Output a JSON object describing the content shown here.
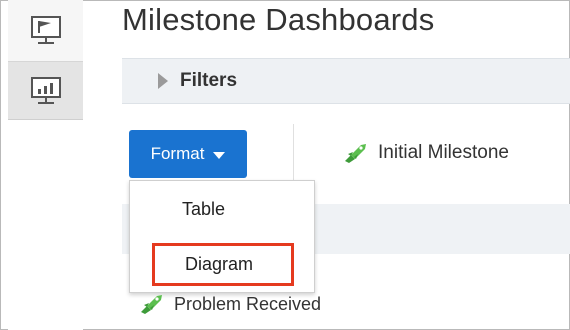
{
  "rail": {
    "tabs": [
      {
        "icon": "presentation-flag-icon"
      },
      {
        "icon": "bar-chart-monitor-icon"
      }
    ]
  },
  "page": {
    "title": "Milestone Dashboards"
  },
  "filters": {
    "label": "Filters"
  },
  "toolbar": {
    "format_label": "Format",
    "accent_color": "#1a73d0"
  },
  "dropdown": {
    "items": [
      {
        "label": "Table"
      },
      {
        "label": "Diagram",
        "highlight_color": "#e53a1f"
      }
    ]
  },
  "milestones": {
    "header_label": "Initial Milestone",
    "row_label": "Problem Received",
    "icon": "rocket-icon",
    "icon_color": "#4caf50"
  }
}
